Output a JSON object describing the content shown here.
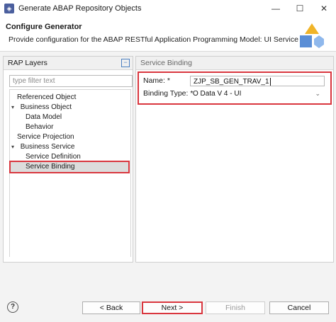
{
  "window": {
    "title": "Generate ABAP Repository Objects",
    "minimize_glyph": "—",
    "maximize_glyph": "☐",
    "close_glyph": "✕"
  },
  "header": {
    "title": "Configure Generator",
    "description": "Provide configuration for the ABAP RESTful Application Programming Model: UI Service"
  },
  "left_panel": {
    "title": "RAP Layers",
    "filter_placeholder": "type filter text",
    "tree": [
      {
        "label": "Referenced Object",
        "level": 1,
        "expander": ""
      },
      {
        "label": "Business Object",
        "level": 0,
        "expander": "▾"
      },
      {
        "label": "Data Model",
        "level": 2,
        "expander": ""
      },
      {
        "label": "Behavior",
        "level": 2,
        "expander": ""
      },
      {
        "label": "Service Projection",
        "level": 1,
        "expander": ""
      },
      {
        "label": "Business Service",
        "level": 0,
        "expander": "▾"
      },
      {
        "label": "Service Definition",
        "level": 2,
        "expander": ""
      },
      {
        "label": "Service Binding",
        "level": 2,
        "expander": "",
        "selected": true
      }
    ]
  },
  "right_panel": {
    "title": "Service Binding",
    "name_label": "Name: *",
    "name_value": "ZJP_SB_GEN_TRAV_1",
    "binding_type_label": "Binding Type: *",
    "binding_type_value": "O Data   V 4 -  UI"
  },
  "footer": {
    "help_glyph": "?",
    "back_label": "< Back",
    "next_label": "Next >",
    "finish_label": "Finish",
    "cancel_label": "Cancel"
  },
  "colors": {
    "highlight": "#d9363e",
    "selection": "#dcdcdc",
    "accent": "#4a7fc1"
  }
}
